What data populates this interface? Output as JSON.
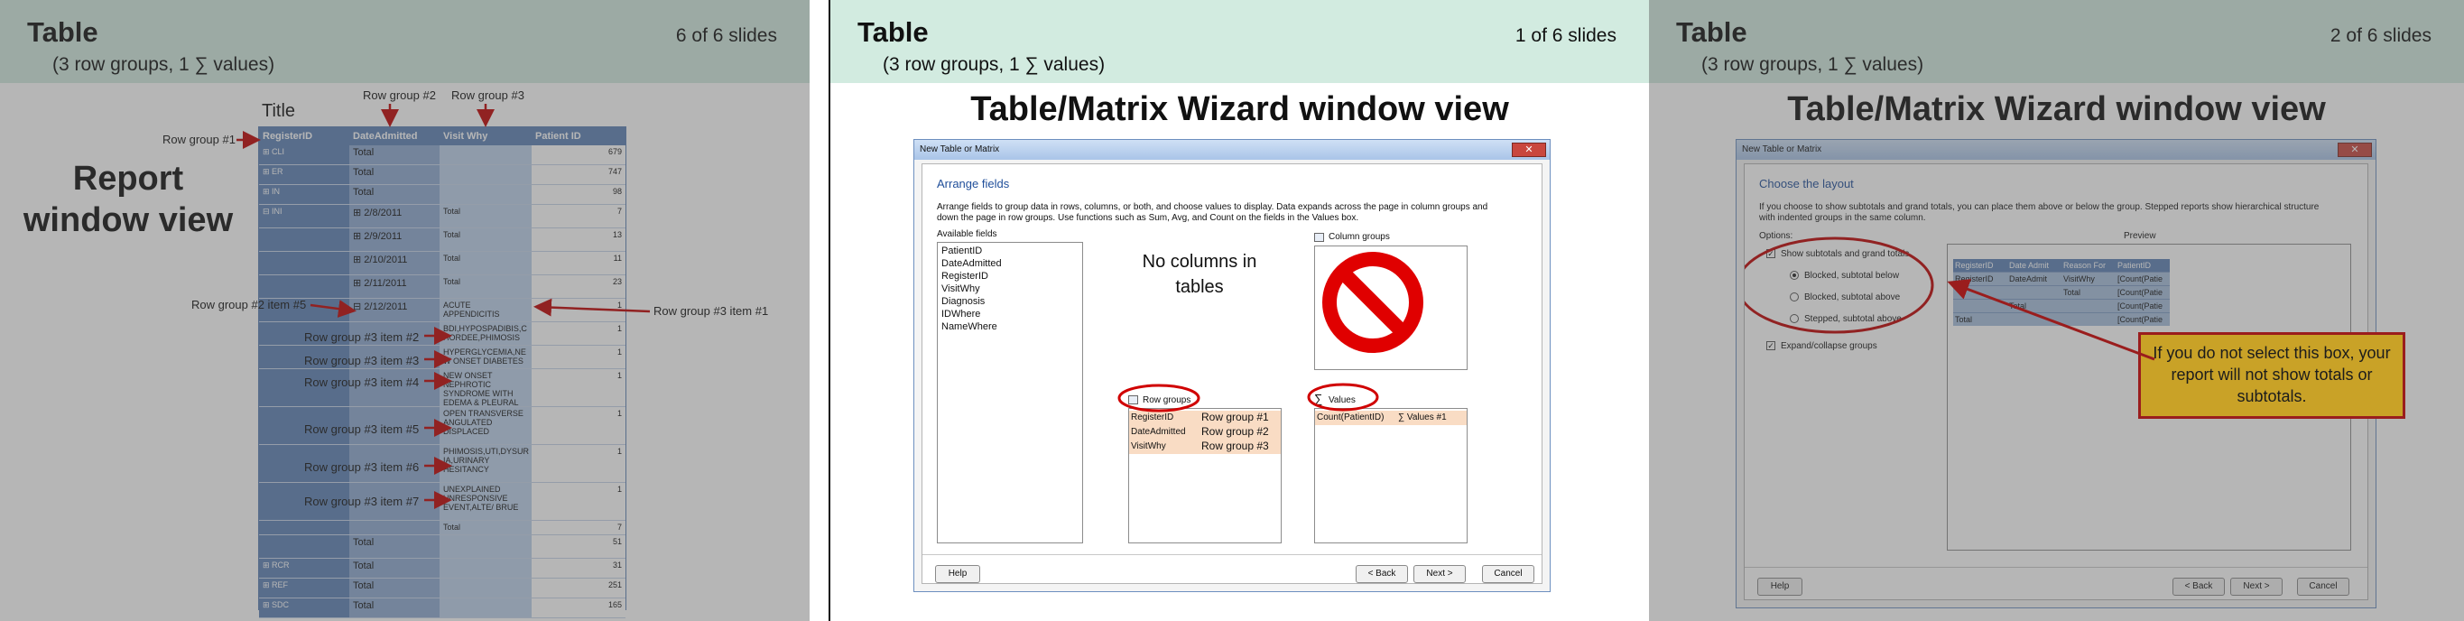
{
  "slides": [
    {
      "title": "Table",
      "subtitle": "(3 row groups, 1 ∑ values)",
      "counter": "6 of 6 slides",
      "heading": "Report\nwindow view",
      "report_title": "Title",
      "columns": [
        "RegisterID",
        "DateAdmitted",
        "Visit Why",
        "Patient ID"
      ],
      "rows": [
        {
          "a": "⊞ CLI",
          "b": "Total",
          "c": "",
          "d": "679"
        },
        {
          "a": "⊞ ER",
          "b": "Total",
          "c": "",
          "d": "747"
        },
        {
          "a": "⊞ IN",
          "b": "Total",
          "c": "",
          "d": "98"
        },
        {
          "a": "⊟ INI",
          "b": "⊞  2/8/2011",
          "c": "Total",
          "d": "7"
        },
        {
          "a": "",
          "b": "⊞  2/9/2011",
          "c": "Total",
          "d": "13"
        },
        {
          "a": "",
          "b": "⊞  2/10/2011",
          "c": "Total",
          "d": "11"
        },
        {
          "a": "",
          "b": "⊞  2/11/2011",
          "c": "Total",
          "d": "23"
        },
        {
          "a": "",
          "b": "⊟  2/12/2011",
          "c": "ACUTE APPENDICITIS",
          "d": "1"
        },
        {
          "a": "",
          "b": "",
          "c": "BDI,HYPOSPADIBIS,C HORDEE,PHIMOSIS",
          "d": "1"
        },
        {
          "a": "",
          "b": "",
          "c": "HYPERGLYCEMIA,NE W ONSET DIABETES",
          "d": "1"
        },
        {
          "a": "",
          "b": "",
          "c": "NEW ONSET NEPHROTIC SYNDROME WITH EDEMA & PLEURAL",
          "d": "1"
        },
        {
          "a": "",
          "b": "",
          "c": "OPEN TRANSVERSE ANGULATED DISPLACED",
          "d": "1"
        },
        {
          "a": "",
          "b": "",
          "c": "PHIMOSIS,UTI,DYSUR IA,URINARY HESITANCY",
          "d": "1"
        },
        {
          "a": "",
          "b": "",
          "c": "UNEXPLAINED UNRESPONSIVE EVENT,ALTE/ BRUE",
          "d": "1"
        },
        {
          "a": "",
          "b": "",
          "c": "Total",
          "d": "7"
        },
        {
          "a": "",
          "b": "Total",
          "c": "",
          "d": "51"
        },
        {
          "a": "⊞ RCR",
          "b": "Total",
          "c": "",
          "d": "31"
        },
        {
          "a": "⊞ REF",
          "b": "Total",
          "c": "",
          "d": "251"
        },
        {
          "a": "⊞ SDC",
          "b": "Total",
          "c": "",
          "d": "165"
        }
      ],
      "annotations": {
        "rg1": "Row group #1",
        "rg2": "Row group #2",
        "rg3": "Row group #3",
        "rg2_item5": "Row group #2 item #5",
        "rg3_item1": "Row group #3 item #1",
        "rg3_item2": "Row group #3 item #2",
        "rg3_item3": "Row group #3 item #3",
        "rg3_item4": "Row group #3 item #4",
        "rg3_item5": "Row group #3 item #5",
        "rg3_item6": "Row group #3 item #6",
        "rg3_item7": "Row group #3 item #7"
      }
    },
    {
      "title": "Table",
      "subtitle": "(3 row groups, 1 ∑ values)",
      "counter": "1 of 6 slides",
      "heading": "Table/Matrix Wizard window view",
      "window_title": "New Table or Matrix",
      "section": "Arrange fields",
      "instructions": "Arrange fields to group data in rows, columns, or both, and choose values to display. Data expands across the page in column groups and down the page in row groups.  Use functions such as Sum, Avg, and Count on the fields in the Values box.",
      "available_label": "Available fields",
      "available_fields": [
        "PatientID",
        "DateAdmitted",
        "RegisterID",
        "VisitWhy",
        "Diagnosis",
        "IDWhere",
        "NameWhere"
      ],
      "no_columns_note": "No columns in tables",
      "column_groups_label": "Column groups",
      "row_groups_label": "Row groups",
      "row_groups": [
        {
          "field": "RegisterID",
          "note": "Row group #1"
        },
        {
          "field": "DateAdmitted",
          "note": "Row group #2"
        },
        {
          "field": "VisitWhy",
          "note": "Row group #3"
        }
      ],
      "values_label": "Values",
      "values_item": "Count(PatientID)",
      "values_note": "∑ Values #1",
      "buttons": {
        "help": "Help",
        "back": "< Back",
        "next": "Next >",
        "cancel": "Cancel"
      }
    },
    {
      "title": "Table",
      "subtitle": "(3 row groups, 1 ∑ values)",
      "counter": "2 of 6 slides",
      "heading": "Table/Matrix Wizard window view",
      "window_title": "New Table or Matrix",
      "section": "Choose the layout",
      "instructions": "If you choose to show subtotals and grand totals, you can place them above or below the group. Stepped reports show hierarchical structure with indented groups in the same column.",
      "options_label": "Options:",
      "preview_label": "Preview",
      "opt_subtotals": "Show subtotals and grand totals",
      "opt_blocked_below": "Blocked, subtotal below",
      "opt_blocked_above": "Blocked, subtotal above",
      "opt_stepped": "Stepped, subtotal above",
      "opt_expand": "Expand/collapse groups",
      "preview_headers": [
        "RegisterID",
        "Date Admit",
        "Reason For",
        "PatientID"
      ],
      "preview_rows": [
        [
          "RegisterID",
          "DateAdmit",
          "VisitWhy",
          "[Count(Patie"
        ],
        [
          "",
          "",
          "Total",
          "[Count(Patie"
        ],
        [
          "",
          "Total",
          "",
          "[Count(Patie"
        ],
        [
          "Total",
          "",
          "",
          "[Count(Patie"
        ]
      ],
      "callout": "If you do not select this box, your report will not show totals or subtotals.",
      "buttons": {
        "help": "Help",
        "back": "< Back",
        "next": "Next >",
        "cancel": "Cancel"
      }
    }
  ],
  "colors": {
    "header_bar": "#d2ebe0",
    "report_blue": "#5d82b6",
    "report_blue_light": "#a8bfdd",
    "arrow_red": "#c00000",
    "callout_fill": "#c9a227",
    "callout_border": "#9a1d1d"
  }
}
